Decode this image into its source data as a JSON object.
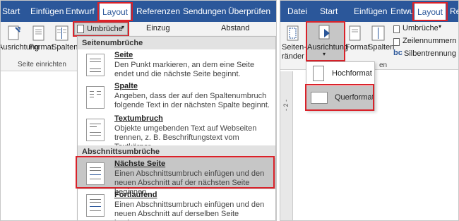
{
  "left": {
    "tabs": [
      "Start",
      "Einfügen",
      "Entwurf",
      "Layout",
      "Referenzen",
      "Sendungen",
      "Überprüfen"
    ],
    "ribbon": {
      "ausrichtung": "Ausrichtung",
      "format": "Format",
      "spalten": "Spalten",
      "umbrueche": "Umbrüche",
      "einzug": "Einzug",
      "abstand": "Abstand",
      "group": "Seite einrichten"
    },
    "menu": {
      "section1": "Seitenumbrüche",
      "section2": "Abschnittsumbrüche",
      "items": [
        {
          "title": "Seite",
          "desc": "Den Punkt markieren, an dem eine Seite endet und die nächste Seite beginnt."
        },
        {
          "title": "Spalte",
          "desc": "Angeben, dass der auf den Spaltenumbruch folgende Text in der nächsten Spalte beginnt."
        },
        {
          "title": "Textumbruch",
          "desc": "Objekte umgebenden Text auf Webseiten trennen, z. B. Beschriftungstext vom Textkörper."
        },
        {
          "title": "Nächste Seite",
          "desc": "Einen Abschnittsumbruch einfügen und den neuen Abschnitt auf der nächsten Seite beginnen."
        },
        {
          "title": "Fortlaufend",
          "desc": "Einen Abschnittsumbruch einfügen und den neuen Abschnitt auf derselben Seite beginnen."
        }
      ]
    }
  },
  "right": {
    "tabs": [
      "Datei",
      "Start",
      "Einfügen",
      "Entwurf",
      "Layout",
      "Re"
    ],
    "ribbon": {
      "seitenraender_1": "Seiten-",
      "seitenraender_2": "ränder",
      "ausrichtung": "Ausrichtung",
      "format": "Format",
      "spalten": "Spalten",
      "umbrueche": "Umbrüche",
      "zeilennummern": "Zeilennummern",
      "silbentrennung": "Silbentrennung",
      "group_fragment": "en"
    },
    "menu": {
      "hochformat": "Hochformat",
      "querformat": "Querformat"
    },
    "ruler": "- 2 -"
  },
  "colors": {
    "accent": "#2b579a",
    "highlight": "#d9222a"
  }
}
